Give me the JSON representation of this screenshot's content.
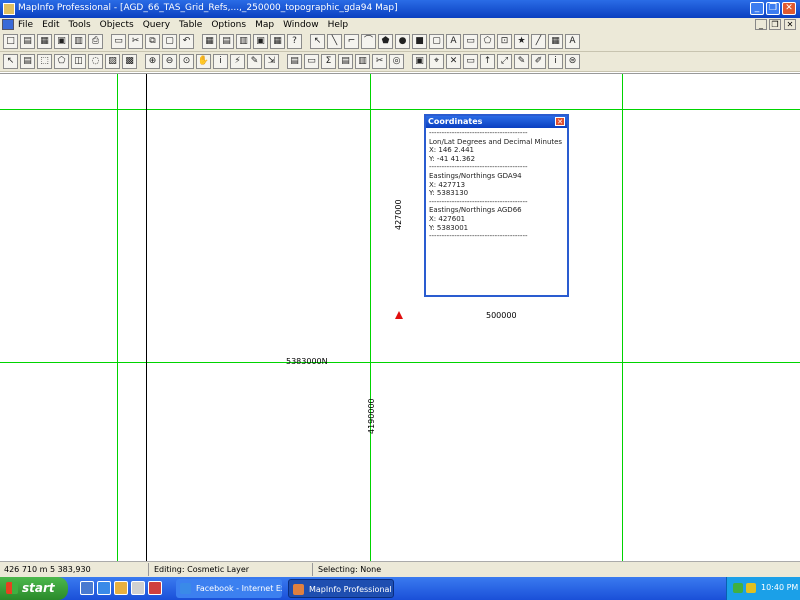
{
  "window": {
    "title": "MapInfo Professional - [AGD_66_TAS_Grid_Refs,...,_250000_topographic_gda94 Map]",
    "minimize_glyph": "_",
    "restore_glyph": "❐",
    "close_glyph": "✕"
  },
  "menubar": {
    "items": [
      "File",
      "Edit",
      "Tools",
      "Objects",
      "Query",
      "Table",
      "Options",
      "Map",
      "Window",
      "Help"
    ],
    "child_controls": [
      "_",
      "❐",
      "✕"
    ]
  },
  "toolbar1": {
    "icons": [
      "new-table-icon",
      "open-table-icon",
      "open-workspace-icon",
      "save-table-icon",
      "save-copy-icon",
      "print-icon",
      "print-preview-icon",
      "cut-icon",
      "copy-icon",
      "paste-icon",
      "undo-icon",
      "new-browser-icon",
      "new-mapper-icon",
      "new-grapher-icon",
      "new-layout-icon",
      "new-redistrict-icon",
      "help-pointer-icon",
      "select-arrow-icon",
      "line-icon",
      "polyline-icon",
      "arc-icon",
      "polygon-icon",
      "ellipse-icon",
      "rectangle-icon",
      "rounded-rect-icon",
      "text-icon",
      "frame-icon",
      "reshape-icon",
      "add-node-icon",
      "symbol-style-icon",
      "line-style-icon",
      "region-style-icon",
      "text-style-icon"
    ],
    "glyphs": [
      "□",
      "▤",
      "▦",
      "▣",
      "▥",
      "⎙",
      "▭",
      "✂",
      "⧉",
      "▢",
      "↶",
      "▦",
      "▤",
      "▥",
      "▣",
      "▦",
      "?",
      "↖",
      "╲",
      "⌐",
      "⌒",
      "⬟",
      "●",
      "■",
      "▢",
      "A",
      "▭",
      "⬠",
      "⊡",
      "★",
      "╱",
      "▦",
      "A"
    ]
  },
  "toolbar2": {
    "icons": [
      "select-icon",
      "radius-select-icon",
      "marquee-select-icon",
      "polygon-select-icon",
      "boundary-select-icon",
      "unselect-all-icon",
      "invert-selection-icon",
      "graph-select-icon",
      "zoom-in-icon",
      "zoom-out-icon",
      "change-view-icon",
      "grabber-icon",
      "info-icon",
      "hotlink-icon",
      "label-icon",
      "drag-map-icon",
      "layer-control-icon",
      "ruler-icon",
      "statistics-icon",
      "legend-icon",
      "create-thematic-icon",
      "clip-region-icon",
      "set-target-icon",
      "show-coords-icon",
      "gps-icon",
      "survey-icon",
      "scale-bar-icon",
      "north-arrow-icon",
      "tool-a-icon",
      "tool-b-icon",
      "tool-c-icon",
      "info-i-icon",
      "overview-icon"
    ],
    "glyphs": [
      "↖",
      "▤",
      "⬚",
      "⬠",
      "◫",
      "◌",
      "▨",
      "▩",
      "⊕",
      "⊖",
      "⊙",
      "✋",
      "i",
      "⚡",
      "✎",
      "⇲",
      "▤",
      "▭",
      "Σ",
      "▤",
      "▥",
      "✂",
      "◎",
      "▣",
      "⌖",
      "✕",
      "▭",
      "↑",
      "⤢",
      "✎",
      "✐",
      "i",
      "⊜"
    ]
  },
  "map": {
    "labels": {
      "easting_500000": "500000",
      "northing_5383000": "5383000N",
      "vertical_top": "427000",
      "vertical_bottom": "4190000"
    },
    "gridline_color": "#00d400",
    "marker_color": "#e01010"
  },
  "coordinates_window": {
    "title": "Coordinates",
    "close_glyph": "✕",
    "lines": [
      "---------------------------------------",
      "Lon/Lat Degrees and Decimal Minutes",
      "X: 146 2.441",
      "Y: -41 41.362",
      "---------------------------------------",
      "Eastings/Northings GDA94",
      "X: 427713",
      "Y: 5383130",
      "---------------------------------------",
      "Eastings/Northings AGD66",
      "X: 427601",
      "Y: 5383001",
      "---------------------------------------"
    ]
  },
  "statusbar": {
    "coords": "426 710 m  5 383,930",
    "editing": "Editing: Cosmetic Layer",
    "selecting": "Selecting: None"
  },
  "taskbar": {
    "start_label": "start",
    "tasks": [
      "Facebook - Internet Explorer",
      "MapInfo Professional - ..."
    ],
    "clock": "10:40 PM"
  }
}
